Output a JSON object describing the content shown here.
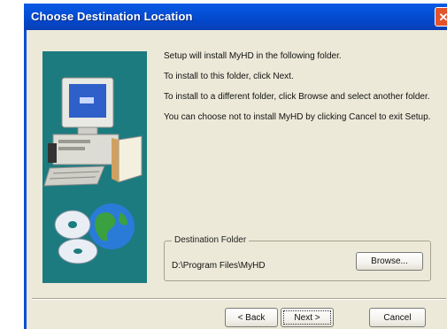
{
  "window": {
    "title": "Choose Destination Location",
    "close_glyph": "✕"
  },
  "body_text": {
    "line1": "Setup will install MyHD  in the following folder.",
    "line2": "To install to this folder, click Next.",
    "line3": "To install to a different folder, click Browse and select another folder.",
    "line4": "You can choose not to install MyHD by clicking Cancel to exit Setup."
  },
  "destination": {
    "legend": "Destination Folder",
    "path": "D:\\Program Files\\MyHD",
    "browse_label": "Browse..."
  },
  "buttons": {
    "back_label": "< Back",
    "next_label": "Next >",
    "cancel_label": "Cancel"
  },
  "icons": {
    "side_illustration": "computer-disc-globe-icon",
    "close": "close-icon"
  },
  "colors": {
    "title_bar": "#0550d8",
    "side_panel": "#1c7b7f",
    "dialog_bg": "#ece9d8",
    "close_button": "#e3532c"
  }
}
